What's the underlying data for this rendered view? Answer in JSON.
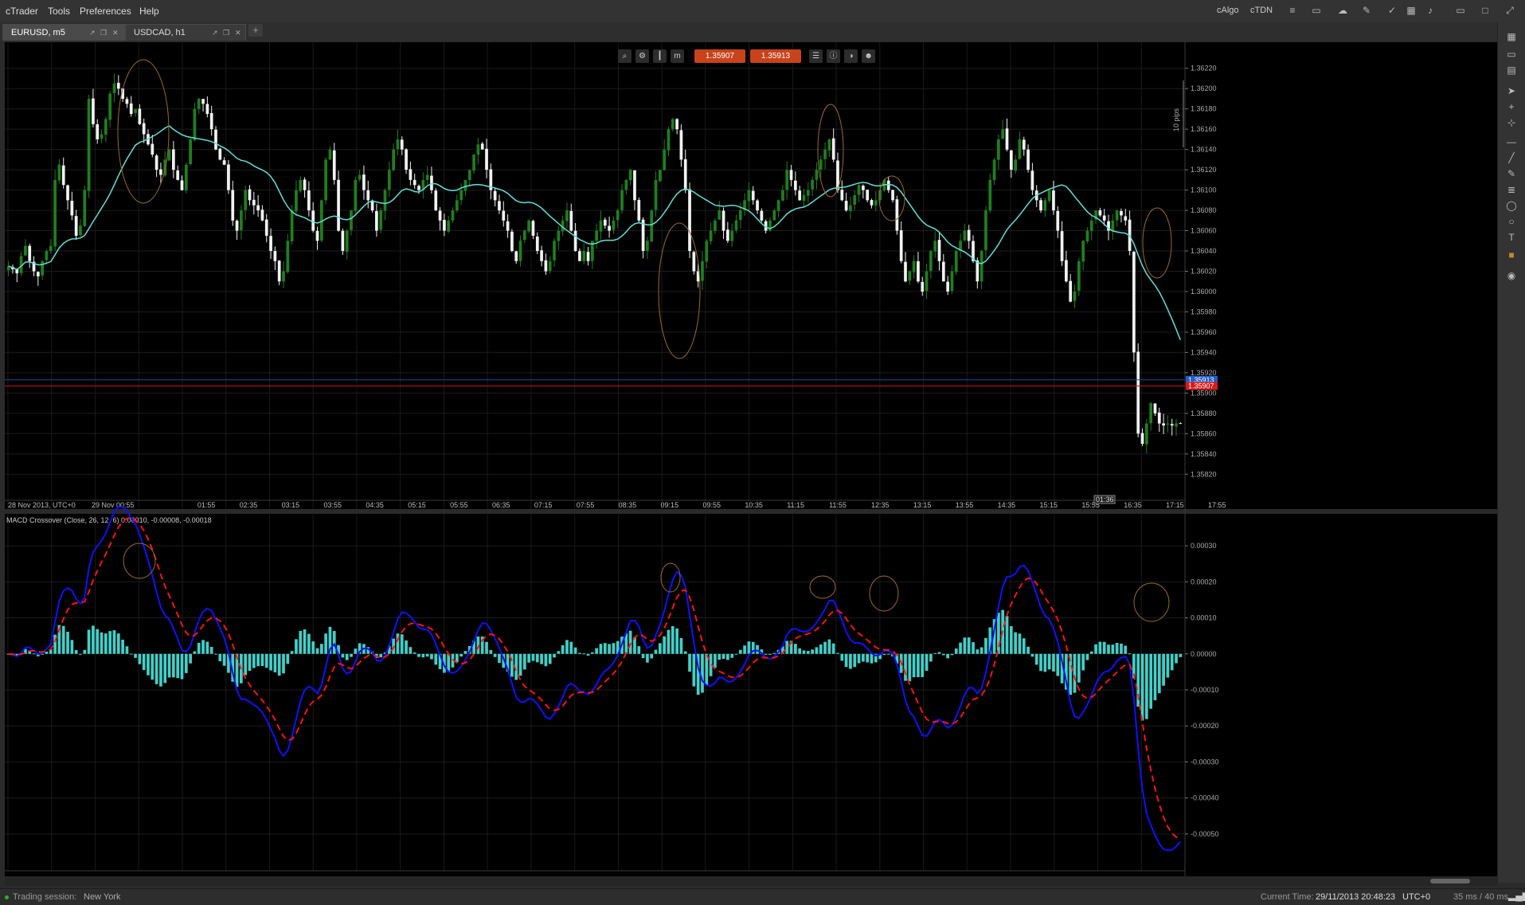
{
  "menu": [
    "cTrader",
    "Tools",
    "Preferences",
    "Help"
  ],
  "toolbar": {
    "calgo": "cAlgo",
    "ctdn": "cTDN"
  },
  "tabs": [
    {
      "label": "EURUSD, m5",
      "active": true
    },
    {
      "label": "USDCAD, h1",
      "active": false
    }
  ],
  "chart_toolbar": {
    "bid_price": "1.35907",
    "ask_price": "1.35913"
  },
  "colors": {
    "bull": "#1e7f1e",
    "bear": "#f2f2f2",
    "ma": "#5ee0d8",
    "macd": "#1010ff",
    "signal": "#ff1010",
    "hist": "#40d0c8",
    "ask_line": "#1a4fa0",
    "bid_line": "#d01010",
    "annot": "#9a6a2a"
  },
  "chart_data": {
    "type": "candlestick",
    "symbol": "EURUSD",
    "timeframe": "m5",
    "ylim": [
      1.3581,
      1.3623
    ],
    "y_ticks": [
      "1.36220",
      "1.36200",
      "1.36180",
      "1.36160",
      "1.36140",
      "1.36120",
      "1.36100",
      "1.36080",
      "1.36060",
      "1.36040",
      "1.36020",
      "1.36000",
      "1.35980",
      "1.35960",
      "1.35940",
      "1.35920",
      "1.35900",
      "1.35880",
      "1.35860",
      "1.35840",
      "1.35820"
    ],
    "x_ticks": [
      "28 Nov 2013, UTC+0",
      "29 Nov 00:55",
      "01:55",
      "02:35",
      "03:15",
      "03:55",
      "04:35",
      "05:15",
      "05:55",
      "06:35",
      "07:15",
      "07:55",
      "08:35",
      "09:15",
      "09:55",
      "10:35",
      "11:15",
      "11:55",
      "12:35",
      "13:15",
      "13:55",
      "14:35",
      "15:15",
      "15:55",
      "16:35",
      "17:15",
      "17:55"
    ],
    "ask_price": "1.35913",
    "bid_price": "1.35907",
    "ask_value": 1.35913,
    "bid_value": 1.35907,
    "pips_label": "10 pips",
    "cursor_time": "01:36",
    "candle_count": 288,
    "closes_anchor": [
      1.36025,
      1.36022,
      1.36018,
      1.36035,
      1.36045,
      1.3603,
      1.3602,
      1.36015,
      1.3603,
      1.3604,
      1.36045,
      1.3611,
      1.36125,
      1.36105,
      1.3609,
      1.36075,
      1.36055,
      1.36065,
      1.361,
      1.3619,
      1.36165,
      1.3615,
      1.36155,
      1.3617,
      1.36195,
      1.36205,
      1.362,
      1.3619,
      1.36185,
      1.36175,
      1.3618,
      1.36165,
      1.36155,
      1.36145,
      1.36135,
      1.3612,
      1.36115,
      1.3613,
      1.3614,
      1.3612,
      1.3611,
      1.361,
      1.36125,
      1.3615,
      1.3618,
      1.3619,
      1.36185,
      1.36175,
      1.3616,
      1.3614,
      1.3613,
      1.36125,
      1.361,
      1.3607,
      1.3606,
      1.3608,
      1.361,
      1.3609,
      1.36085,
      1.3608,
      1.3607,
      1.36055,
      1.3604,
      1.3603,
      1.3601,
      1.3602,
      1.3605,
      1.3608,
      1.361,
      1.3611,
      1.361,
      1.3608,
      1.3606,
      1.3605,
      1.3609,
      1.3613,
      1.3614,
      1.3611,
      1.3606,
      1.3604,
      1.3606,
      1.3608,
      1.3611,
      1.36115,
      1.361,
      1.3609,
      1.3608,
      1.3606,
      1.3608,
      1.361,
      1.3612,
      1.3614,
      1.3615,
      1.3614,
      1.3612,
      1.3611,
      1.36105,
      1.361,
      1.3611,
      1.36115,
      1.361,
      1.3608,
      1.3607,
      1.3606,
      1.3607,
      1.3608,
      1.3609,
      1.361,
      1.3611,
      1.3612,
      1.36135,
      1.36145,
      1.3614,
      1.3612,
      1.361,
      1.3609,
      1.3608,
      1.3607,
      1.3606,
      1.3604,
      1.3603,
      1.3605,
      1.3606,
      1.3607,
      1.36055,
      1.3604,
      1.3603,
      1.3602,
      1.3603,
      1.3605,
      1.3606,
      1.3607,
      1.3608,
      1.3606,
      1.3604,
      1.3603,
      1.3604,
      1.3603,
      1.3605,
      1.3606,
      1.3607,
      1.36065,
      1.3606,
      1.3607,
      1.3608,
      1.361,
      1.3611,
      1.3612,
      1.3609,
      1.3607,
      1.3604,
      1.3605,
      1.3608,
      1.3611,
      1.3612,
      1.3614,
      1.3616,
      1.3617,
      1.3616,
      1.3613,
      1.361,
      1.3604,
      1.3602,
      1.3601,
      1.3603,
      1.3605,
      1.3606,
      1.3607,
      1.3608,
      1.3606,
      1.3605,
      1.3606,
      1.3607,
      1.3608,
      1.3609,
      1.361,
      1.3609,
      1.3608,
      1.3607,
      1.3606,
      1.3607,
      1.3608,
      1.3609,
      1.361,
      1.3612,
      1.3611,
      1.361,
      1.3609,
      1.36095,
      1.361,
      1.3611,
      1.3612,
      1.3613,
      1.3614,
      1.3615,
      1.3613,
      1.361,
      1.3609,
      1.3608,
      1.36085,
      1.36095,
      1.36105,
      1.361,
      1.3609,
      1.36085,
      1.3609,
      1.361,
      1.3611,
      1.361,
      1.3609,
      1.3606,
      1.3603,
      1.3601,
      1.3602,
      1.3603,
      1.3601,
      1.36,
      1.3602,
      1.3604,
      1.3605,
      1.3603,
      1.3601,
      1.36,
      1.3602,
      1.3604,
      1.3605,
      1.3606,
      1.3605,
      1.3603,
      1.3601,
      1.3604,
      1.3608,
      1.3611,
      1.3613,
      1.3615,
      1.3616,
      1.3614,
      1.3612,
      1.3613,
      1.3615,
      1.3614,
      1.3612,
      1.361,
      1.3609,
      1.3608,
      1.3609,
      1.361,
      1.3608,
      1.3606,
      1.3603,
      1.3601,
      1.3599,
      1.36,
      1.3603,
      1.3605,
      1.3606,
      1.3607,
      1.3608,
      1.36075,
      1.3607,
      1.3606,
      1.3607,
      1.3608,
      1.36075,
      1.3607,
      1.3604,
      1.3594,
      1.3586,
      1.3585,
      1.3587,
      1.3589,
      1.3588,
      1.3587,
      1.35868,
      1.3587,
      1.35868,
      1.3587,
      1.3587
    ],
    "ma_label": "",
    "indicator": {
      "title": "MACD Crossover (Close, 26, 12, 6) 0.00010, -0.00008, -0.00018",
      "ylim": [
        -0.00058,
        0.00036
      ],
      "y_ticks": [
        "0.00030",
        "0.00020",
        "0.00010",
        "0.00000",
        "-0.00010",
        "-0.00020",
        "-0.00030",
        "-0.00040",
        "-0.00050"
      ]
    }
  },
  "right_panel_icons": [
    "layout-icon",
    "single-chart-icon",
    "multi-chart-icon",
    "cursor-icon",
    "crosshair-icon",
    "zoom-icon",
    "hline-icon",
    "trendline-icon",
    "pencil-icon",
    "fib-icon",
    "ellipse-icon",
    "circle-icon",
    "text-icon",
    "color-icon",
    "camera-icon"
  ],
  "status": {
    "session_label": "Trading session:",
    "session_value": "New York",
    "current_time_label": "Current Time:",
    "current_time_value": "29/11/2013 20:48:23",
    "timezone": "UTC+0",
    "latency": "35 ms / 40 ms"
  }
}
